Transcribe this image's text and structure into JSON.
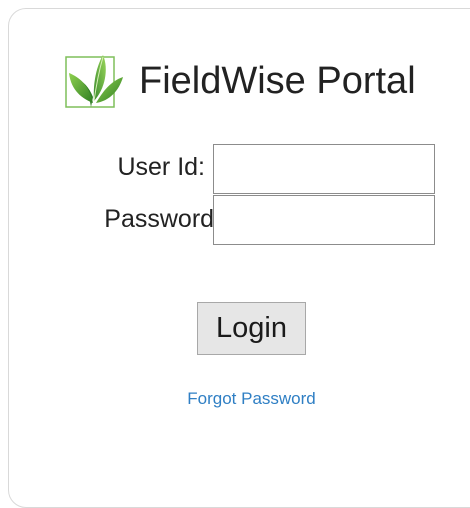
{
  "app": {
    "title": "FieldWise Portal",
    "logo_icon": "leaf-sprout-icon",
    "brand_color": "#3a8a2e"
  },
  "form": {
    "userid_label": "User Id:",
    "userid_value": "",
    "password_label": "Password:",
    "password_value": "",
    "login_label": "Login",
    "forgot_label": "Forgot Password",
    "link_color": "#2f7fc4"
  }
}
